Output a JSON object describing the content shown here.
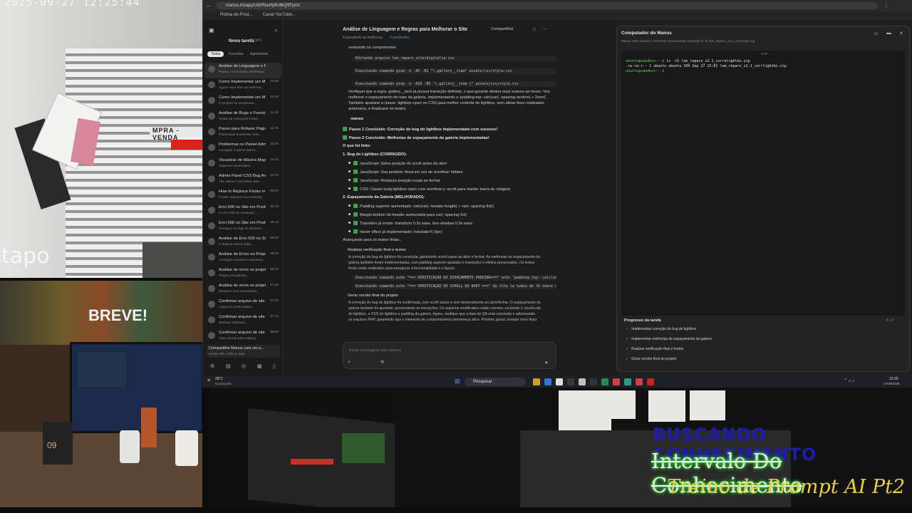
{
  "overlay": {
    "cam1_timestamp": "2025-09-27 12:25:44",
    "cam1_brand": "tapo",
    "cam1_sign": "MPRA - VENDA",
    "cam2_screen_text": "BREVE!",
    "cam2_calendar": "09",
    "title_line1": "BUSCANDO CONHECIMENTO",
    "title_line2": "Intervalo Do Conhecimento",
    "title_line3": "Treino de Prompt AI Pt2"
  },
  "browser": {
    "url": "manus.im/app/U8zRbuHpfU4bQ9Fpmz",
    "bookmarks": [
      "Rotina de Prod...",
      "Canal YouTube..."
    ]
  },
  "sidebar": {
    "new_task": "Nova tarefa",
    "shortcut": "Ctrl K",
    "filters": [
      "Todas",
      "Favoritas",
      "Agendadas"
    ],
    "items": [
      {
        "title": "Análise de Linguagem e Reg...",
        "sub": "Passo 2 Concluído: Melhorias...",
        "date": ""
      },
      {
        "title": "Como Implementar um M...",
        "sub": "Agora você tem um sistema...",
        "date": "12:05"
      },
      {
        "title": "Como Implementar um M...",
        "sub": "O projeto foi atualizado...",
        "date": "12:00"
      },
      {
        "title": "Análise de Bugs e Funcio...",
        "sub": "Todas as correções foram...",
        "date": "11:48"
      },
      {
        "title": "Passo para Refazer Página A...",
        "sub": "Publicação finalizada com...",
        "date": "11:30"
      },
      {
        "title": "Problemas no Painel Admin A...",
        "sub": "Corrigido o painel admin...",
        "date": "11:02"
      },
      {
        "title": "Visualizar de Música Mapeam...",
        "sub": "Arquivos atualizados...",
        "date": "10:44"
      },
      {
        "title": "Admin Panel CSS Bug Analy...",
        "sub": "The admin CSS issue was...",
        "date": "10:21"
      },
      {
        "title": "How to Replace Footer in ga...",
        "sub": "Footer replaced successfully",
        "date": "09:57"
      },
      {
        "title": "Erro 500 no Site em Produção...",
        "sub": "O erro 500 foi resolvido...",
        "date": "09:40"
      },
      {
        "title": "Erro 500 no Site em Produção...",
        "sub": "Verifique os logs do servidor",
        "date": "09:12"
      },
      {
        "title": "Análise de Erro 500 no Site e...",
        "sub": "A análise indica falha...",
        "date": "08:55"
      },
      {
        "title": "Análise de Erros no Projeto...",
        "sub": "Corrigido conforme solicitado",
        "date": "08:30"
      },
      {
        "title": "Análise de erros no projeto...",
        "sub": "Projeto atualizado...",
        "date": "08:02"
      },
      {
        "title": "Análise de erros no projeto...",
        "sub": "Nenhum erro encontrado...",
        "date": "07:45"
      },
      {
        "title": "Confirmar arquivo de site do...",
        "sub": "Arquivos confirmados...",
        "date": "07:30"
      },
      {
        "title": "Confirmar arquivo de site do...",
        "sub": "Backup realizado...",
        "date": "07:12"
      },
      {
        "title": "Confirmar arquivo de site do...",
        "sub": "Tudo pronto para deploy",
        "date": "06:58"
      }
    ],
    "share_title": "Compartilhe Manus com um a...",
    "share_sub": "Ganhe 500 créditos cada"
  },
  "chat": {
    "title": "Análise de Linguagem e Regras para Melhorar o Site",
    "share_label": "Compartilhar",
    "subtitle": "Expandindo as melhorias",
    "subtitle_link": "4 pendentes",
    "lines": [
      {
        "kind": "text",
        "text": "revisando os componentes"
      },
      {
        "kind": "code",
        "text": "Editando arquivo  lom_reparo_site/digitalia.css"
      },
      {
        "kind": "code",
        "text": "Executando comando  grep -n -A5 -B2 \"\\.gallery__item\" assets/css/style.css"
      },
      {
        "kind": "code",
        "text": "Executando comando  grep -n -A10 -B5 \"\\.gallery__item {\" assets/css/style.css"
      },
      {
        "kind": "text",
        "text": "Verifiquei que a regra .gallery__item já possui transição definida, o que garante efeitos mais suaves ao hover. Vou"
      },
      {
        "kind": "text",
        "text": "melhorar o espaçamento do topo da galeria, implementando o 'padding-top: calc(var(--spacing-section) + 2rem)'."
      },
      {
        "kind": "text",
        "text": "Também ajustarei a classe .lightbox-open no CSS para melhor controle do lightbox, sem afetar fixes realizados"
      },
      {
        "kind": "text",
        "text": "anteriores, e finalizarei os testes."
      }
    ],
    "manus_label": "manus",
    "steps": [
      "Passo 1 Concluído: Correção do bug do lightbox implementado com sucesso!",
      "Passo 2 Concluído: Melhorias de espaçamento da galeria implementadas!"
    ],
    "done_heading": "O que foi feito:",
    "section1": "1. Bug do Lightbox (CORRIGIDO):",
    "section1_items": [
      "JavaScript: Salva posição do scroll antes de abrir",
      "JavaScript: Usa position: fixed em vez de overflow: hidden",
      "JavaScript: Restaura posição exata ao fechar",
      "CSS: Classe body.lightbox-open com overflow-y: scroll para manter barra de rolagem"
    ],
    "section2": "2. Espaçamento da Galeria (MELHORADO):",
    "section2_items": [
      "Padding superior aumentado: calc(var(--header-height) + var(--spacing-8xl))",
      "Margin-bottom do header aumentada para var(--spacing-5xl)",
      "Transition já existe: transform 0.3s ease, box-shadow 0.3s ease",
      "Hover effect já implementado: translateY(-5px)"
    ],
    "advancing": "Avançando para os testes finais...",
    "task1_title": "Realizar verificação final e testes",
    "task1_body": [
      "A correção do bug do lightbox foi concluída, garantindo scroll suave ao abrir e fechar. As melhorias no espaçamento da",
      "galeria também foram implementadas, com padding superior ajustado e transições e efeitos preservados. Os testes",
      "finais serão realizados para assegurar a funcionalidade e o layout."
    ],
    "task1_cmds": [
      "Executando comando  echo \"=== VERIFICAÇÃO DO ESPAÇAMENTO PADDING===\" echo 'padding-top: calc(var(--header-heig...",
      "Executando comando  echo \"=== VERIFICAÇÃO DO SCROLL DO BODY ===\" && file la tudiu de JS sobre os 'li..."
    ],
    "task2_title": "Gerar versão final do projeto",
    "task2_body": [
      "A correção do bug do lightbox foi confirmada, com scroll suave e sem deslocamento ao abrir/fechar. O espaçamento da",
      "galeria também foi ajustado, preservando as transições. Os arquivos modificados estão corretos, incluindo o JavaScript",
      "do lightbox, o CSS do lightbox e padding da galeria. Agora, verifique que a fase de QA está concluída e adicionando",
      "os arquivos PHP, garantindo que o elemento de comportamento permaneça ativo. Próximo passo: instalar novo fluxo."
    ],
    "input_placeholder": "Envie mensagem para Manus"
  },
  "manus_panel": {
    "title": "Computador do Manus",
    "subtitle": "Manus está usando o Terminal  |  Executando comando  ls -lh lom_reparo_v2.1_correcoes.zip",
    "term_tab": "shell",
    "term_lines": [
      {
        "prompt": "ubuntu@sandbox:~ $",
        "cmd": " ls -lh lom_reparo_v2.1_correlightbx.zip"
      },
      {
        "prompt": "",
        "cmd": "-rw-rw-r-- 1 ubuntu ubuntu 109 Sep 27 15:01 lom_reparo_v2.1_corrlightbx.zip"
      },
      {
        "prompt": "ubuntu@sandbox:~ $",
        "cmd": ""
      }
    ],
    "progress_title": "Progresso da tarefa",
    "progress_count": "4 / 4",
    "progress_items": [
      "Implementar correção do bug do lightbox",
      "Implementar melhorias de espaçamento da galeria",
      "Realizar verificação final e testes",
      "Gerar versão final do projeto"
    ]
  },
  "taskbar": {
    "weather_temp": "28°C",
    "weather_desc": "Ensolarado",
    "search": "Pesquisar",
    "time": "12:25",
    "date": "27/09/2025"
  }
}
